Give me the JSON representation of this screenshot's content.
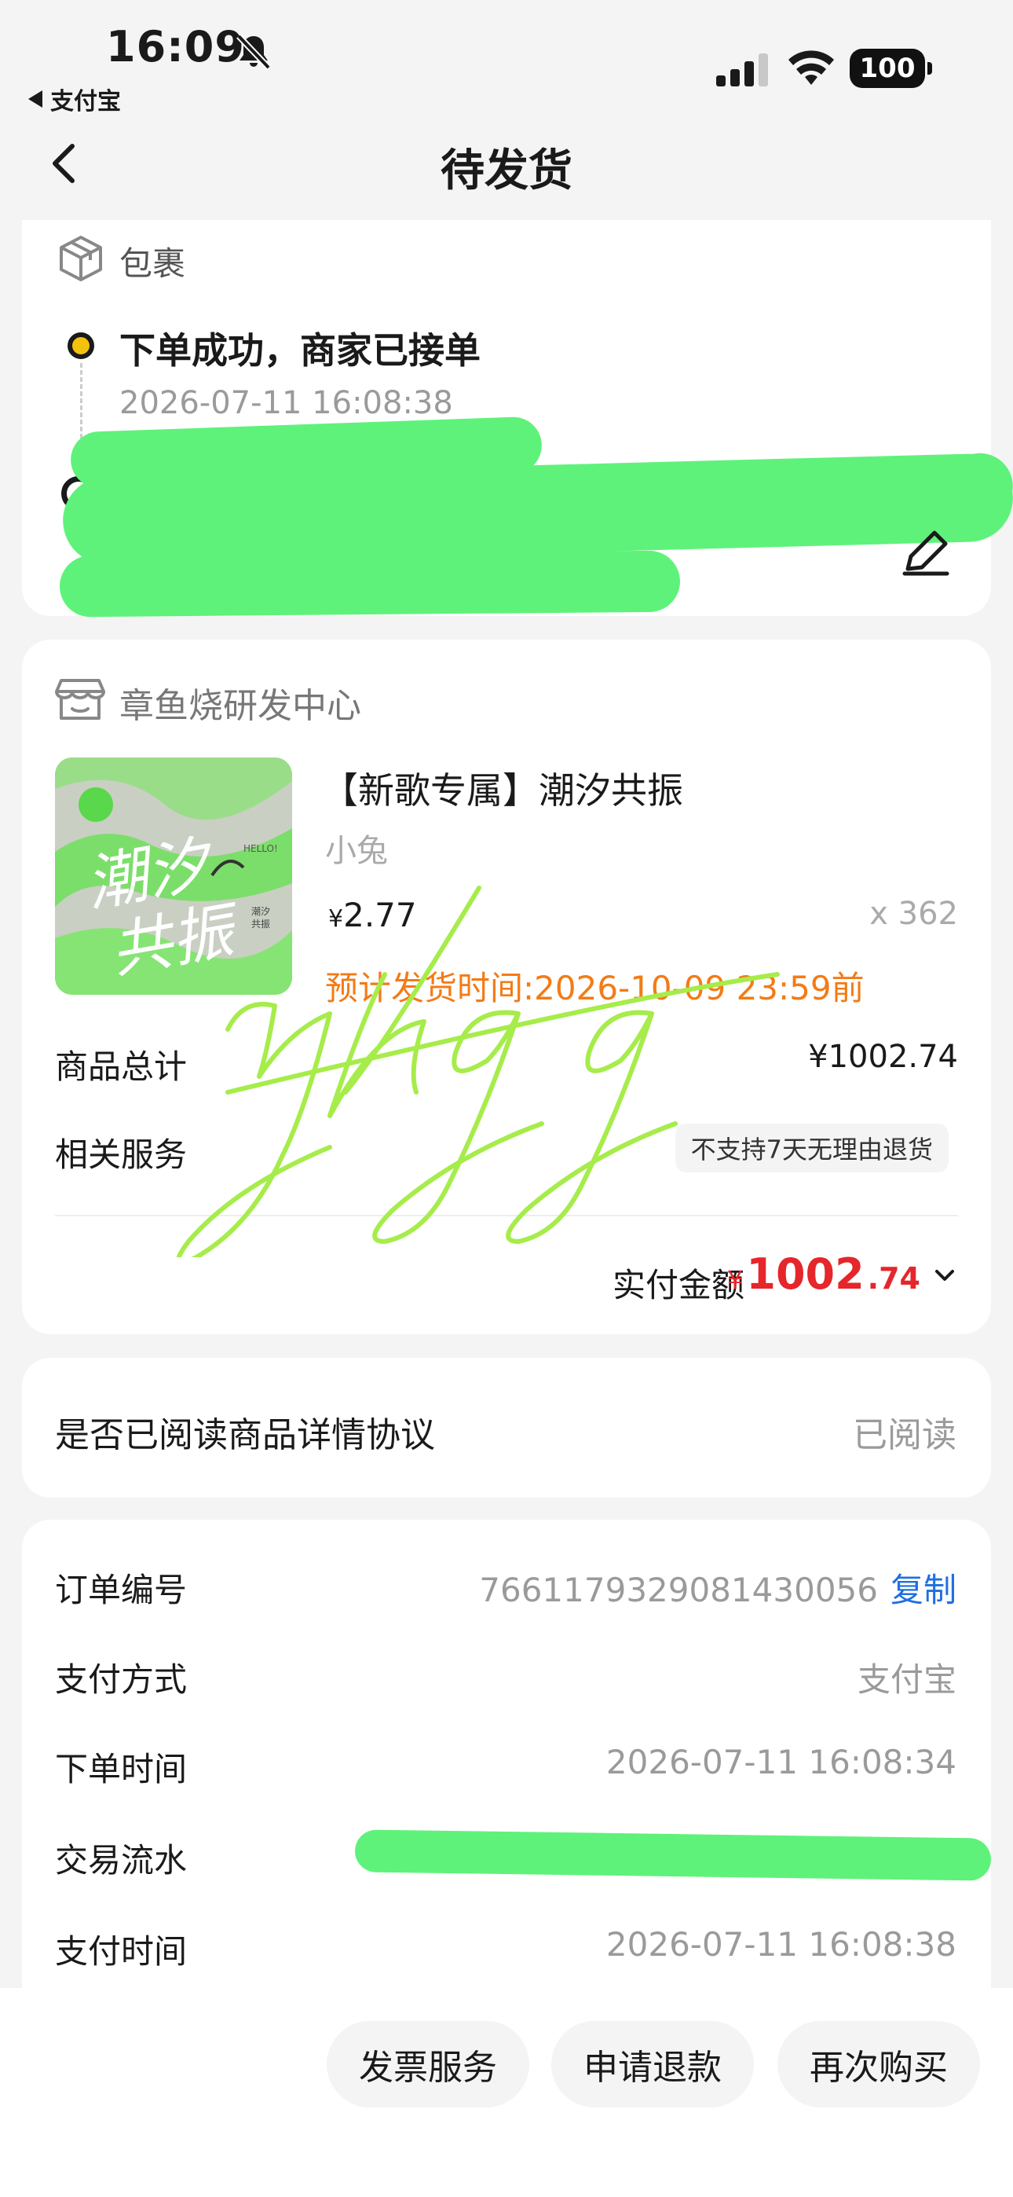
{
  "status_bar": {
    "time": "16:09",
    "back_app": "支付宝",
    "battery": "100"
  },
  "nav": {
    "title": "待发货"
  },
  "package": {
    "title": "包裹",
    "step_title": "下单成功，商家已接单",
    "step_time": "2026-07-11 16:08:38"
  },
  "shop": {
    "name": "章鱼烧研发中心",
    "product": {
      "title": "【新歌专属】潮汐共振",
      "artist": "小兔",
      "price_symbol": "¥",
      "price": "2.77",
      "qty": "x 362",
      "ship_time": "预计发货时间:2026-10-09 23:59前",
      "cover_text_1": "潮汐",
      "cover_text_2": "共振",
      "cover_small_1": "潮汐",
      "cover_small_2": "共振",
      "cover_label": "HELLO!"
    },
    "total_label": "商品总计",
    "total_value": "¥1002.74",
    "service_label": "相关服务",
    "service_tag": "不支持7天无理由退货",
    "paid_label": "实付金额",
    "paid_symbol": "¥",
    "paid_int": "1002",
    "paid_dec": ".74"
  },
  "agreement": {
    "label": "是否已阅读商品详情协议",
    "value": "已阅读"
  },
  "order": {
    "rows": [
      {
        "label": "订单编号",
        "value": "7661179329081430056"
      },
      {
        "label": "支付方式",
        "value": "支付宝"
      },
      {
        "label": "下单时间",
        "value": "2026-07-11 16:08:34"
      },
      {
        "label": "交易流水",
        "value": ""
      },
      {
        "label": "支付时间",
        "value": "2026-07-11 16:08:38"
      }
    ],
    "copy_label": "复制"
  },
  "actions": {
    "invoice": "发票服务",
    "refund": "申请退款",
    "rebuy": "再次购买"
  },
  "watermark": "yhqq",
  "colors": {
    "accent_orange": "#f37b16",
    "price_red": "#e5262b",
    "link_blue": "#1e6fe0",
    "dot_yellow": "#f4c20d"
  }
}
